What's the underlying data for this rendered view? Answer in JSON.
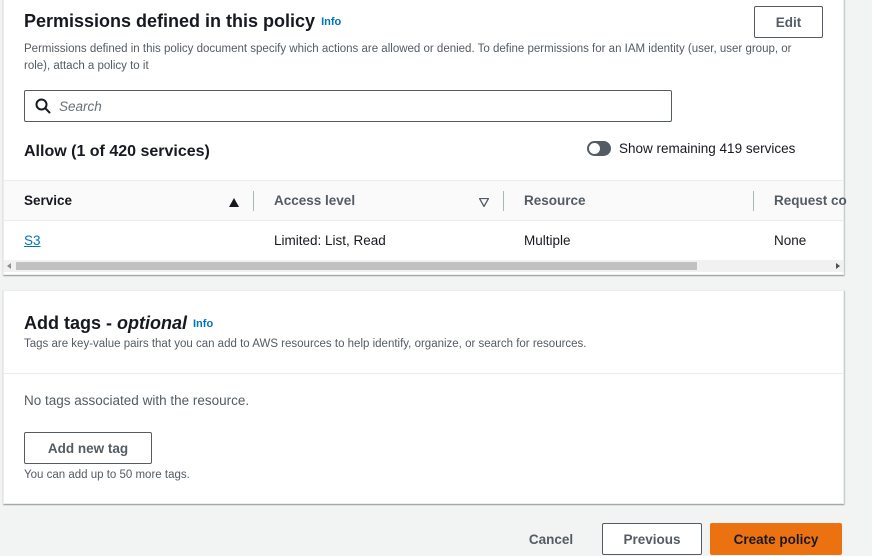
{
  "permissions": {
    "title": "Permissions defined in this policy",
    "info": "Info",
    "edit_label": "Edit",
    "description": "Permissions defined in this policy document specify which actions are allowed or denied. To define permissions for an IAM identity (user, user group, or role), attach a policy to it",
    "search_placeholder": "Search",
    "allow_heading": "Allow (1 of 420 services)",
    "toggle_label": "Show remaining 419 services",
    "toggle_on": false,
    "columns": [
      "Service",
      "Access level",
      "Resource",
      "Request co"
    ],
    "rows": [
      {
        "service": "S3",
        "access_level": "Limited: List, Read",
        "resource": "Multiple",
        "request_condition": "None"
      }
    ]
  },
  "tags": {
    "title_main": "Add tags - ",
    "title_optional": "optional",
    "info": "Info",
    "description": "Tags are key-value pairs that you can add to AWS resources to help identify, organize, or search for resources.",
    "empty_text": "No tags associated with the resource.",
    "add_button": "Add new tag",
    "hint": "You can add up to 50 more tags."
  },
  "footer": {
    "cancel": "Cancel",
    "previous": "Previous",
    "create": "Create policy"
  },
  "colors": {
    "accent": "#ec7211",
    "link": "#0073bb",
    "text": "#16191f",
    "muted": "#545b64"
  },
  "icons": {
    "search": "search-icon",
    "sort_asc": "sort-ascending-icon",
    "sort_desc": "sort-descending-icon"
  }
}
